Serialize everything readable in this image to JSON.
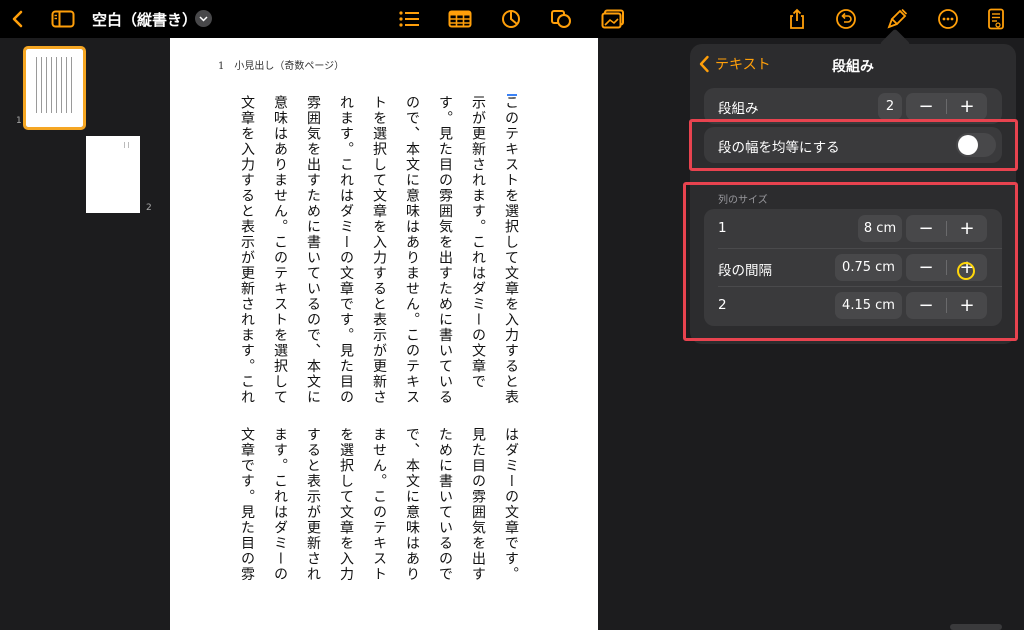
{
  "toolbar": {
    "doc_title": "空白（縦書き）",
    "left_icons": [
      "chevron-left-icon",
      "sidebar-icon"
    ],
    "center_icons": [
      "list-icon",
      "table-icon",
      "chart-icon",
      "shapes-icon",
      "media-icon"
    ],
    "right_icons": [
      "share-icon",
      "undo-icon",
      "format-brush-icon",
      "more-icon",
      "reader-icon"
    ],
    "accent": "#ff9f0a"
  },
  "sidebar": {
    "pages": [
      {
        "number": "1",
        "selected": true
      },
      {
        "number": "2",
        "selected": false
      }
    ]
  },
  "document": {
    "running_head": "1　小見出し（奇数ページ）",
    "top_columns": [
      "このテキストを選択して文章を入力すると表",
      "示が更新されます。これはダミーの文章で",
      "す。見た目の雰囲気を出すために書いている",
      "ので、本文に意味はありません。このテキス",
      "トを選択して文章を入力すると表示が更新さ",
      "れます。これはダミーの文章です。見た目の",
      "雰囲気を出すために書いているので、本文に",
      "意味はありません。このテキストを選択して",
      "文章を入力すると表示が更新されます。これ"
    ],
    "bottom_columns": [
      "はダミーの文章です。",
      "見た目の雰囲気を出す",
      "ために書いているので",
      "で、本文に意味はあり",
      "ません。このテキスト",
      "を選択して文章を入力",
      "すると表示が更新され",
      "ます。これはダミーの",
      "文章です。見た目の雰"
    ]
  },
  "popover": {
    "back_label": "テキスト",
    "title": "段組み",
    "columns_row": {
      "label": "段組み",
      "value": "2"
    },
    "equal_width_row": {
      "label": "段の幅を均等にする",
      "on": false
    },
    "section_label": "列のサイズ",
    "size_rows": [
      {
        "label": "1",
        "value": "8 cm"
      },
      {
        "label": "段の間隔",
        "value": "0.75 cm"
      },
      {
        "label": "2",
        "value": "4.15 cm"
      }
    ],
    "minus": "−",
    "plus": "+"
  },
  "colors": {
    "highlight": "#e8434f",
    "tap_indicator": "#ffd60a"
  }
}
